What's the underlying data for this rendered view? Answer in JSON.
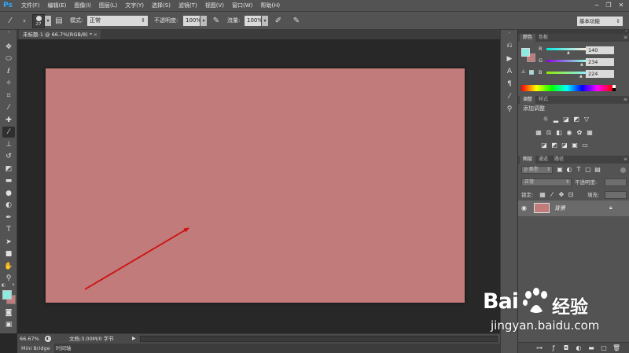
{
  "app": {
    "logo": "Ps"
  },
  "menu": [
    "文件(F)",
    "编辑(E)",
    "图像(I)",
    "图层(L)",
    "文字(Y)",
    "选择(S)",
    "滤镜(T)",
    "视图(V)",
    "窗口(W)",
    "帮助(H)"
  ],
  "window_controls": {
    "minimize": "−",
    "restore": "❐",
    "close": "✕"
  },
  "options": {
    "brush_size": "27",
    "mode_label": "模式:",
    "mode_value": "正常",
    "opacity_label": "不透明度:",
    "opacity_value": "100%",
    "flow_label": "流量:",
    "flow_value": "100%",
    "workspace": "基本功能"
  },
  "document_tab": {
    "title": "未标题-1 @ 66.7%(RGB/8) *",
    "close": "×"
  },
  "status": {
    "zoom": "66.67%",
    "doc_info": "文档:3.00M/0 字节"
  },
  "bottom_tabs": [
    "Mini Bridge",
    "时间轴"
  ],
  "color_panel": {
    "tabs": [
      "颜色",
      "色板"
    ],
    "channels": [
      {
        "label": "R",
        "value": "140"
      },
      {
        "label": "G",
        "value": "234"
      },
      {
        "label": "B",
        "value": "224"
      }
    ],
    "foreground_color": "#8ceae0",
    "background_color": "#c17b7a"
  },
  "adjustments_panel": {
    "tabs": [
      "调整",
      "样式"
    ],
    "heading": "添加调整"
  },
  "layers_panel": {
    "tabs": [
      "图层",
      "通道",
      "路径"
    ],
    "filter_label": "ρ 类型",
    "blend_mode": "正常",
    "opacity_label": "不透明度:",
    "lock_label": "锁定:",
    "fill_label": "填充:",
    "layer_name": "背景",
    "layer_thumb_color": "#c17b7a"
  },
  "canvas": {
    "fill_color": "#c17b7a"
  },
  "annotation": {
    "arrow_color": "#cc1111"
  },
  "watermark": {
    "brand_left": "Bai",
    "brand_right": "经验",
    "url": "jingyan.baidu.com"
  }
}
